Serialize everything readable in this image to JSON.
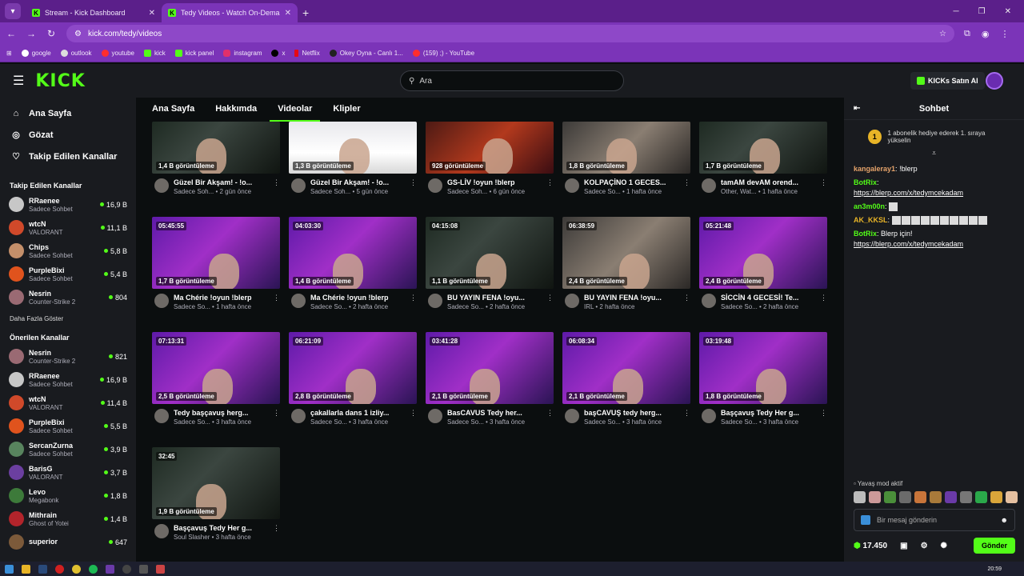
{
  "browser": {
    "tabs": [
      {
        "title": "Stream - Kick Dashboard",
        "active": false
      },
      {
        "title": "Tedy Videos - Watch On-Demand",
        "active": true
      }
    ],
    "url": "kick.com/tedy/videos",
    "bookmarks": [
      "google",
      "outlook",
      "youtube",
      "kick",
      "kick panel",
      "instagram",
      "x",
      "Netflix",
      "Okey Oyna - Canlı 1...",
      "(159) ;) - YouTube"
    ]
  },
  "header": {
    "logo": "KICK",
    "search_placeholder": "Ara",
    "kicks_button": "KICKs Satın Al"
  },
  "sidebar": {
    "nav": [
      {
        "label": "Ana Sayfa",
        "icon": "home-icon"
      },
      {
        "label": "Gözat",
        "icon": "browse-icon"
      },
      {
        "label": "Takip Edilen Kanallar",
        "icon": "heart-icon"
      }
    ],
    "followed_title": "Takip Edilen Kanallar",
    "followed": [
      {
        "name": "RRaenee",
        "category": "Sadece Sohbet",
        "viewers": "16,9 B",
        "color": "#c7c7c7"
      },
      {
        "name": "wtcN",
        "category": "VALORANT",
        "viewers": "11,1 B",
        "color": "#d0492a"
      },
      {
        "name": "Chips",
        "category": "Sadece Sohbet",
        "viewers": "5,8 B",
        "color": "#c48f6a"
      },
      {
        "name": "PurpleBixi",
        "category": "Sadece Sohbet",
        "viewers": "5,4 B",
        "color": "#e0531d"
      },
      {
        "name": "Nesrin",
        "category": "Counter-Strike 2",
        "viewers": "804",
        "color": "#9a6a73"
      }
    ],
    "show_more": "Daha Fazla Göster",
    "recommended_title": "Önerilen Kanallar",
    "recommended": [
      {
        "name": "Nesrin",
        "category": "Counter-Strike 2",
        "viewers": "821",
        "color": "#9a6a73"
      },
      {
        "name": "RRaenee",
        "category": "Sadece Sohbet",
        "viewers": "16,9 B",
        "color": "#c7c7c7"
      },
      {
        "name": "wtcN",
        "category": "VALORANT",
        "viewers": "11,4 B",
        "color": "#d0492a"
      },
      {
        "name": "PurpleBixi",
        "category": "Sadece Sohbet",
        "viewers": "5,5 B",
        "color": "#e0531d"
      },
      {
        "name": "SercanZurna",
        "category": "Sadece Sohbet",
        "viewers": "3,9 B",
        "color": "#58845e"
      },
      {
        "name": "BarisG",
        "category": "VALORANT",
        "viewers": "3,7 B",
        "color": "#6b3fa0"
      },
      {
        "name": "Levo",
        "category": "Megabonk",
        "viewers": "1,8 B",
        "color": "#3d7a3a"
      },
      {
        "name": "Mithrain",
        "category": "Ghost of Yotei",
        "viewers": "1,4 B",
        "color": "#b2242b"
      },
      {
        "name": "superior",
        "category": "",
        "viewers": "647",
        "color": "#7c5a3a"
      }
    ]
  },
  "channel_tabs": [
    "Ana Sayfa",
    "Hakkımda",
    "Videolar",
    "Klipler"
  ],
  "videos": [
    {
      "duration": "",
      "views": "1,4 B görüntüleme",
      "title": "Güzel Bir Akşam! - !o...",
      "sub": "Sadece Soh... • 2 gün önce",
      "style": "t-dark"
    },
    {
      "duration": "",
      "views": "1,3 B görüntüleme",
      "title": "Güzel Bir Akşam! - !o...",
      "sub": "Sadece Soh... • 5 gün önce",
      "style": "t-white"
    },
    {
      "duration": "",
      "views": "928 görüntüleme",
      "title": "GS-LİV !oyun !blerp",
      "sub": "Sadece Soh... • 6 gün önce",
      "style": "t-red"
    },
    {
      "duration": "",
      "views": "1,8 B görüntüleme",
      "title": "KOLPAÇİNO 1 GECES...",
      "sub": "Sadece So... • 1 hafta önce",
      "style": "t-gray"
    },
    {
      "duration": "",
      "views": "1,7 B görüntüleme",
      "title": "tamAM devAM orend...",
      "sub": "Other, Wat... • 1 hafta önce",
      "style": "t-dark"
    },
    {
      "duration": "05:45:55",
      "views": "1,7 B görüntüleme",
      "title": "Ma Chérie !oyun !blerp",
      "sub": "Sadece So... • 1 hafta önce",
      "style": "t-purple"
    },
    {
      "duration": "04:03:30",
      "views": "1,4 B görüntüleme",
      "title": "Ma Chérie !oyun !blerp",
      "sub": "Sadece So... • 2 hafta önce",
      "style": "t-purple"
    },
    {
      "duration": "04:15:08",
      "views": "1,1 B görüntüleme",
      "title": "BU YAYIN FENA !oyu...",
      "sub": "Sadece So... • 2 hafta önce",
      "style": "t-dark"
    },
    {
      "duration": "06:38:59",
      "views": "2,4 B görüntüleme",
      "title": "BU YAYIN FENA !oyu...",
      "sub": "IRL • 2 hafta önce",
      "style": "t-gray"
    },
    {
      "duration": "05:21:48",
      "views": "2,4 B görüntüleme",
      "title": "SİCCİN 4 GECESİ! Te...",
      "sub": "Sadece So... • 2 hafta önce",
      "style": "t-purple"
    },
    {
      "duration": "07:13:31",
      "views": "2,5 B görüntüleme",
      "title": "Tedy başçavuş herg...",
      "sub": "Sadece So... • 3 hafta önce",
      "style": "t-purple"
    },
    {
      "duration": "06:21:09",
      "views": "2,8 B görüntüleme",
      "title": "çakallarla dans 1 izliy...",
      "sub": "Sadece So... • 3 hafta önce",
      "style": "t-purple"
    },
    {
      "duration": "03:41:28",
      "views": "2,1 B görüntüleme",
      "title": "BasCAVUS Tedy her...",
      "sub": "Sadece So... • 3 hafta önce",
      "style": "t-purple"
    },
    {
      "duration": "06:08:34",
      "views": "2,1 B görüntüleme",
      "title": "başCAVUŞ tedy herg...",
      "sub": "Sadece So... • 3 hafta önce",
      "style": "t-purple"
    },
    {
      "duration": "03:19:48",
      "views": "1,8 B görüntüleme",
      "title": "Başçavuş Tedy Her g...",
      "sub": "Sadece So... • 3 hafta önce",
      "style": "t-purple"
    },
    {
      "duration": "32:45",
      "views": "1,9 B görüntüleme",
      "title": "Başçavuş Tedy Her g...",
      "sub": "Soul Slasher • 3 hafta önce",
      "style": "t-dark"
    }
  ],
  "chat": {
    "title": "Sohbet",
    "pinned": "1 abonelik hediye ederek 1. sıraya yükselin",
    "pinned_rank": "1",
    "messages": [
      {
        "user": "kangaleray1",
        "color": "#e5a36a",
        "text": "!blerp",
        "link": ""
      },
      {
        "user": "BotRix",
        "color": "#53fc18",
        "text": "",
        "link": "https://blerp.com/x/tedymcekadam"
      },
      {
        "user": "an3m00n",
        "color": "#53fc18",
        "text": "",
        "link": ""
      },
      {
        "user": "AK_KKSL",
        "color": "#e8b427",
        "text": "",
        "link": ""
      },
      {
        "user": "BotRix",
        "color": "#53fc18",
        "text": "Blerp için!",
        "link": "https://blerp.com/x/tedymcekadam"
      }
    ],
    "slow_mode": "Yavaş mod aktif",
    "input_placeholder": "Bir mesaj gönderin",
    "points": "17.450",
    "send_label": "Gönder"
  },
  "taskbar": {
    "time": "20:59"
  }
}
